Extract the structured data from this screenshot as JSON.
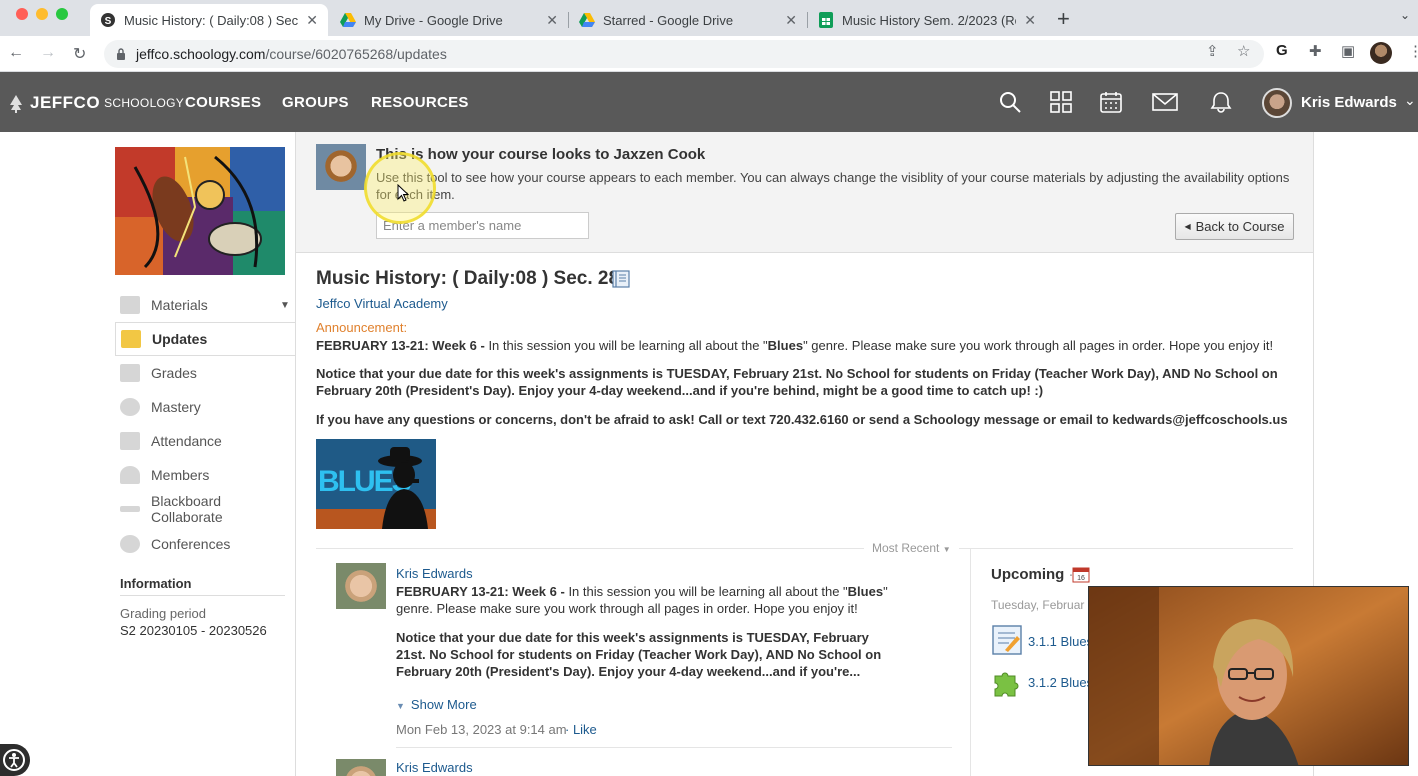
{
  "browser": {
    "tabs": [
      {
        "title": "Music History: ( Daily:08 ) Sec",
        "active": true
      },
      {
        "title": "My Drive - Google Drive",
        "active": false
      },
      {
        "title": "Starred - Google Drive",
        "active": false
      },
      {
        "title": "Music History Sem. 2/2023 (Re",
        "active": false
      }
    ],
    "url_host": "jeffco.schoology.com",
    "url_path": "/course/6020765268/updates"
  },
  "header": {
    "logo_jeffco": "JEFFCO",
    "logo_schoology": "SCHOOLOGY",
    "nav": [
      "COURSES",
      "GROUPS",
      "RESOURCES"
    ],
    "icons": [
      "search-icon",
      "apps-grid-icon",
      "calendar-icon",
      "messages-icon",
      "notifications-icon"
    ],
    "user_name": "Kris Edwards"
  },
  "sidebar": {
    "items": [
      {
        "label": "Materials",
        "icon": "materials-icon"
      },
      {
        "label": "Updates",
        "icon": "updates-icon"
      },
      {
        "label": "Grades",
        "icon": "grades-icon"
      },
      {
        "label": "Mastery",
        "icon": "mastery-icon"
      },
      {
        "label": "Attendance",
        "icon": "attendance-icon"
      },
      {
        "label": "Members",
        "icon": "members-icon"
      },
      {
        "label": "Blackboard Collaborate",
        "icon": "blackboard-icon"
      },
      {
        "label": "Conferences",
        "icon": "conferences-icon"
      }
    ],
    "information_title": "Information",
    "grading_period_label": "Grading period",
    "grading_period_value": "S2 20230105 - 20230526"
  },
  "impersonate": {
    "title": "This is how your course looks to Jaxzen Cook",
    "description": "Use this tool to see how your course appears to each member. You can always change the visiblity of your course materials by adjusting the availability options for each item.",
    "search_placeholder": "Enter a member's name",
    "back_button": "Back to Course"
  },
  "course": {
    "title": "Music History: ( Daily:08 ) Sec. 281",
    "school": "Jeffco Virtual Academy"
  },
  "announcement": {
    "label": "Announcement:",
    "p1_bold": "FEBRUARY 13-21: Week 6 - ",
    "p1_a": "In this session you will be learning all about the \"",
    "p1_word": "Blues",
    "p1_b": "\" genre.  Please make sure you work through all pages in order. Hope you enjoy it!",
    "p2": "Notice that your due date for this week's assignments is TUESDAY, February 21st. No School for students on Friday (Teacher Work Day), AND No School on February 20th (President's Day).  Enjoy your 4-day weekend...and if you're behind, might be a good time to catch up! :)",
    "p3": "If you have any questions or concerns, don't be afraid to ask!  Call or text 720.432.6160 or send a Schoology message or email to kedwards@jeffcoschools.us"
  },
  "feed": {
    "sort_label": "Most Recent",
    "posts": [
      {
        "author": "Kris Edwards",
        "p1_bold": "FEBRUARY 13-21: Week 6 - ",
        "p1_a": "In this session you will be learning all about the \"",
        "p1_word": "Blues",
        "p1_b": "\" genre.  Please make sure you work through all pages in order. Hope you enjoy it!",
        "p2": "Notice that your due date for this week's assignments is TUESDAY, February 21st. No School for students on Friday (Teacher Work Day), AND No School on February 20th (President's Day).  Enjoy your 4-day weekend...and if you're...",
        "show_more": "Show More",
        "timestamp": "Mon Feb 13, 2023 at 9:14 am",
        "like": "· Like"
      },
      {
        "author": "Kris Edwards"
      }
    ]
  },
  "upcoming": {
    "title": "Upcoming",
    "separator": "·",
    "date": "Tuesday, Februar",
    "items": [
      {
        "label": "3.1.1 Blues",
        "icon": "assignment-icon"
      },
      {
        "label": "3.1.2 Blues",
        "icon": "puzzle-icon"
      }
    ]
  },
  "colors": {
    "header_bg": "#595959",
    "link": "#1d5a8e",
    "announcement_label": "#e0812e",
    "active_item_icon": "#f2c744"
  }
}
